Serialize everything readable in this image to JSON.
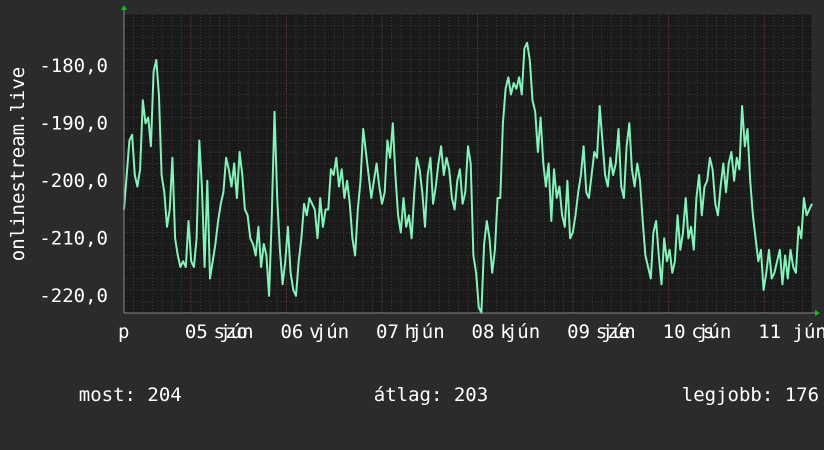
{
  "chart_data": {
    "type": "line",
    "ylabel": "onlinestream.live",
    "ylim": [
      -223,
      -171
    ],
    "y_ticks": [
      {
        "value": -180,
        "label": "-180,0"
      },
      {
        "value": -190,
        "label": "-190,0"
      },
      {
        "value": -200,
        "label": "-200,0"
      },
      {
        "value": -210,
        "label": "-210,0"
      },
      {
        "value": -220,
        "label": "-220,0"
      }
    ],
    "x_ticks": [
      {
        "label": "p",
        "x": 0.5
      },
      {
        "label": "05 jún",
        "x": 1.2
      },
      {
        "label": "szo",
        "x": 1.5
      },
      {
        "label": "06 jún",
        "x": 2.2
      },
      {
        "label": "v",
        "x": 2.5
      },
      {
        "label": "07 jún",
        "x": 3.2
      },
      {
        "label": "h",
        "x": 3.5
      },
      {
        "label": "08 jún",
        "x": 4.2
      },
      {
        "label": "k",
        "x": 4.5
      },
      {
        "label": "09 jún",
        "x": 5.2
      },
      {
        "label": "sze",
        "x": 5.5
      },
      {
        "label": "10 jún",
        "x": 6.2
      },
      {
        "label": "cs",
        "x": 6.5
      },
      {
        "label": "11 jún",
        "x": 7.2
      }
    ],
    "xlim": [
      0.5,
      7.7
    ],
    "grid": true,
    "colors": {
      "background": "#2b2b2b",
      "plot_area": "#1a1a1a",
      "grid_minor": "#3a3a3a",
      "grid_major": "#6a3a3a",
      "line": "#7ff5b8",
      "axis_arrow": "#00cc00"
    },
    "series": [
      {
        "values": [
          -205,
          -199,
          -193,
          -192,
          -199,
          -201,
          -198,
          -186,
          -190,
          -189,
          -194,
          -181,
          -179,
          -185,
          -199,
          -202,
          -208,
          -205,
          -196,
          -210,
          -213,
          -215,
          -214,
          -215,
          -207,
          -214,
          -215,
          -210,
          -193,
          -201,
          -215,
          -200,
          -217,
          -214,
          -211,
          -207,
          -204,
          -202,
          -196,
          -198,
          -201,
          -197,
          -203,
          -195,
          -199,
          -205,
          -206,
          -210,
          -211,
          -213,
          -208,
          -215,
          -211,
          -213,
          -220,
          -206,
          -188,
          -203,
          -212,
          -218,
          -214,
          -208,
          -216,
          -219,
          -220,
          -214,
          -210,
          -204,
          -206,
          -203,
          -204,
          -205,
          -210,
          -203,
          -208,
          -205,
          -205,
          -198,
          -199,
          -196,
          -201,
          -198,
          -203,
          -200,
          -204,
          -210,
          -213,
          -205,
          -200,
          -191,
          -195,
          -199,
          -203,
          -200,
          -197,
          -201,
          -204,
          -202,
          -193,
          -196,
          -190,
          -199,
          -206,
          -209,
          -203,
          -208,
          -206,
          -210,
          -202,
          -196,
          -198,
          -202,
          -208,
          -199,
          -196,
          -204,
          -201,
          -197,
          -194,
          -199,
          -196,
          -198,
          -203,
          -205,
          -200,
          -198,
          -204,
          -202,
          -194,
          -197,
          -213,
          -216,
          -222,
          -223,
          -211,
          -207,
          -210,
          -216,
          -212,
          -203,
          -203,
          -190,
          -184,
          -182,
          -185,
          -183,
          -184,
          -182,
          -185,
          -177,
          -176,
          -179,
          -186,
          -188,
          -195,
          -189,
          -197,
          -201,
          -197,
          -207,
          -198,
          -203,
          -201,
          -206,
          -208,
          -200,
          -210,
          -209,
          -206,
          -202,
          -199,
          -194,
          -202,
          -203,
          -199,
          -195,
          -196,
          -187,
          -193,
          -199,
          -201,
          -196,
          -199,
          -197,
          -191,
          -201,
          -203,
          -194,
          -190,
          -198,
          -201,
          -197,
          -200,
          -207,
          -213,
          -215,
          -217,
          -209,
          -207,
          -213,
          -218,
          -210,
          -214,
          -212,
          -216,
          -214,
          -206,
          -212,
          -209,
          -203,
          -210,
          -208,
          -212,
          -203,
          -199,
          -206,
          -201,
          -200,
          -196,
          -198,
          -204,
          -206,
          -201,
          -197,
          -202,
          -197,
          -195,
          -200,
          -196,
          -198,
          -187,
          -194,
          -191,
          -200,
          -206,
          -210,
          -214,
          -212,
          -219,
          -216,
          -212,
          -217,
          -216,
          -214,
          -212,
          -218,
          -213,
          -217,
          -212,
          -215,
          -216,
          -208,
          -210,
          -203,
          -206,
          -205,
          -204
        ]
      }
    ]
  },
  "stats": {
    "now_label": "most:",
    "now_value": "204",
    "avg_label": "átlag:",
    "avg_value": "203",
    "best_label": "legjobb:",
    "best_value": "176"
  }
}
